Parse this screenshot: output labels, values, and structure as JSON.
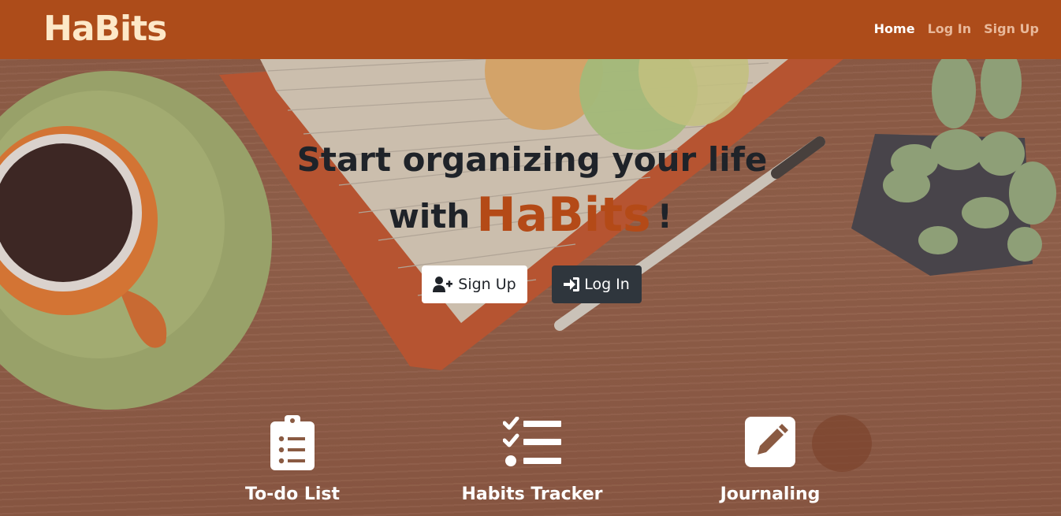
{
  "navbar": {
    "brand": "HaBits",
    "links": [
      {
        "label": "Home",
        "active": true
      },
      {
        "label": "Log In",
        "active": false
      },
      {
        "label": "Sign Up",
        "active": false
      }
    ]
  },
  "hero": {
    "headline_line1": "Start organizing your life",
    "headline_with": "with",
    "headline_brand": "HaBits",
    "headline_bang": "!",
    "buttons": {
      "signup": {
        "label": "Sign Up",
        "icon": "user-plus-icon"
      },
      "login": {
        "label": "Log In",
        "icon": "sign-in-icon"
      }
    }
  },
  "features": [
    {
      "label": "To-do List",
      "icon": "clipboard-list-icon"
    },
    {
      "label": "Habits Tracker",
      "icon": "checklist-icon"
    },
    {
      "label": "Journaling",
      "icon": "edit-icon"
    }
  ],
  "colors": {
    "navbar": "#ad4c1a",
    "brand_text": "#fde8c8",
    "accent": "#b44a17",
    "dark_button": "#2f363d"
  }
}
